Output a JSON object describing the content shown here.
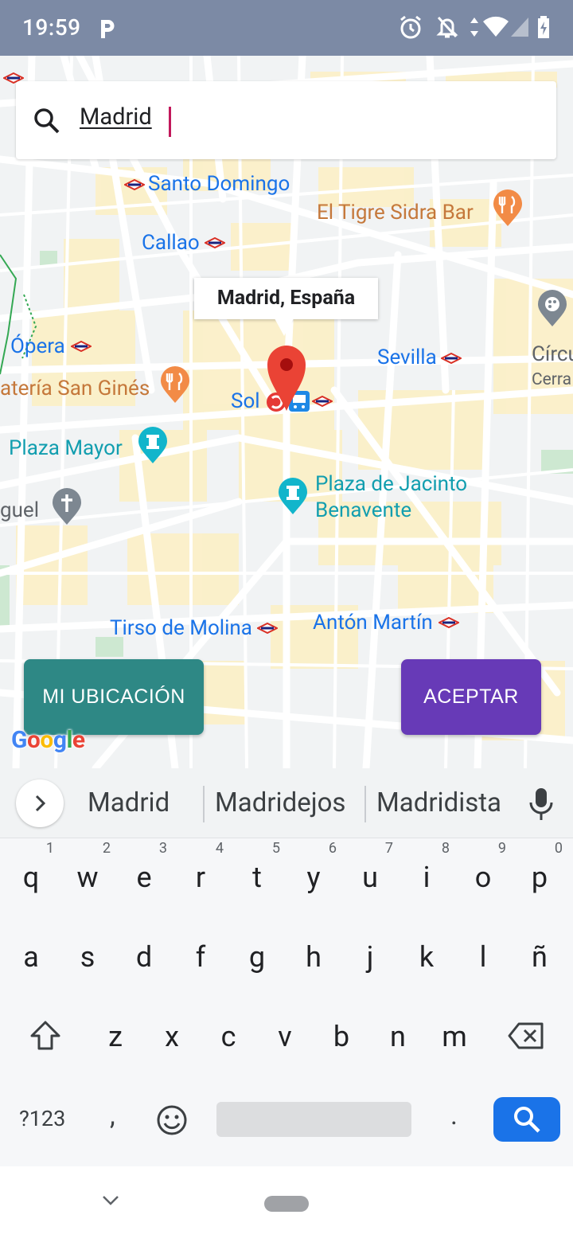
{
  "status_bar": {
    "time": "19:59",
    "icons": [
      "parking-icon",
      "alarm-icon",
      "notifications-off-icon",
      "data-arrows-icon",
      "wifi-icon",
      "signal-icon",
      "battery-charging-icon"
    ]
  },
  "search": {
    "value": "Madrid",
    "icon": "search-icon"
  },
  "map": {
    "info_window": "Madrid, España",
    "labels": {
      "santo_domingo": "Santo Domingo",
      "tigre": "El Tigre Sidra Bar",
      "callao": "Callao",
      "opera": "Ópera",
      "san_gines": "atería San Ginés",
      "sol": "Sol",
      "sevilla": "Sevilla",
      "circ": "Círcu",
      "cerra": "Cerra",
      "plaza_mayor": "Plaza Mayor",
      "jacinto_1": "Plaza de Jacinto",
      "jacinto_2": "Benavente",
      "miguel": "guel",
      "tirso": "Tirso de Molina",
      "anton": "Antón Martín"
    },
    "brand": "Google"
  },
  "buttons": {
    "location": "MI UBICACIÓN",
    "accept": "ACEPTAR"
  },
  "keyboard": {
    "suggestions": [
      "Madrid",
      "Madridejos",
      "Madridista"
    ],
    "row1": [
      {
        "ch": "q",
        "num": "1"
      },
      {
        "ch": "w",
        "num": "2"
      },
      {
        "ch": "e",
        "num": "3"
      },
      {
        "ch": "r",
        "num": "4"
      },
      {
        "ch": "t",
        "num": "5"
      },
      {
        "ch": "y",
        "num": "6"
      },
      {
        "ch": "u",
        "num": "7"
      },
      {
        "ch": "i",
        "num": "8"
      },
      {
        "ch": "o",
        "num": "9"
      },
      {
        "ch": "p",
        "num": "0"
      }
    ],
    "row2": [
      "a",
      "s",
      "d",
      "f",
      "g",
      "h",
      "j",
      "k",
      "l",
      "ñ"
    ],
    "row3": [
      "z",
      "x",
      "c",
      "v",
      "b",
      "n",
      "m"
    ],
    "symbols_label": "?123",
    "comma": ",",
    "period": "."
  },
  "colors": {
    "status_bar": "#7c8aa5",
    "location_button": "#2e8885",
    "accept_button": "#673ab7",
    "search_key": "#1a73e8",
    "pin": "#ea4335"
  }
}
